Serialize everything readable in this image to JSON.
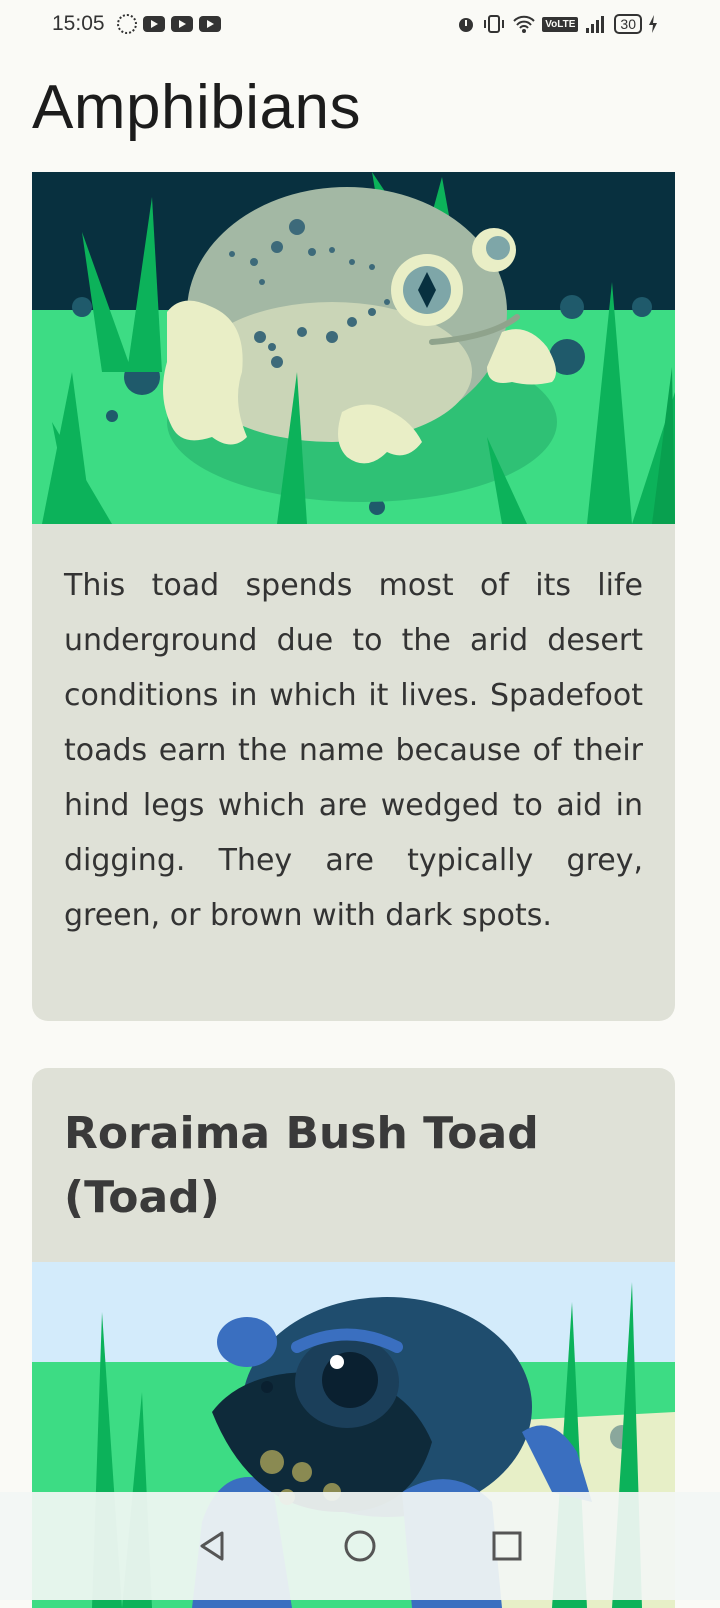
{
  "status_bar": {
    "time": "15:05",
    "network_label": "VoLTE",
    "battery": "30",
    "icons": [
      "loading-icon",
      "youtube-icon",
      "youtube-icon",
      "youtube-icon",
      "alarm-icon",
      "vibrate-icon",
      "wifi-icon",
      "volte-icon",
      "signal-icon",
      "battery-icon",
      "charging-icon"
    ]
  },
  "page": {
    "title": "Amphibians"
  },
  "cards": [
    {
      "image_name": "spadefoot-toad-illustration",
      "description": "This toad spends most of its life underground due to the arid desert conditions in which it lives. Spadefoot toads earn the name because of their hind legs which are wedged to aid in digging. They are typically grey, green, or brown with dark spots."
    },
    {
      "title": "Roraima Bush Toad (Toad)",
      "image_name": "roraima-bush-toad-illustration"
    }
  ],
  "nav_bar": {
    "buttons": [
      "back-icon",
      "home-icon",
      "recents-icon"
    ]
  },
  "colors": {
    "background": "#fafaf6",
    "card": "#dfe1d7",
    "grass": "#3ddc84",
    "night_sky": "#08303f",
    "toad_blue": "#1f4d6e"
  }
}
